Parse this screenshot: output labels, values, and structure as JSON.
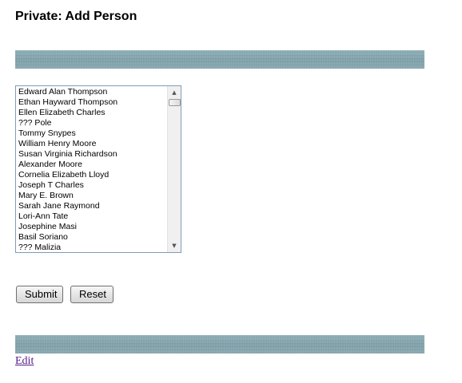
{
  "page": {
    "title": "Private: Add Person"
  },
  "person_list": {
    "items": [
      "Edward Alan Thompson",
      "Ethan Hayward Thompson",
      "Ellen Elizabeth Charles",
      "??? Pole",
      "Tommy Snypes",
      "William Henry Moore",
      "Susan Virginia Richardson",
      "Alexander Moore",
      "Cornelia Elizabeth Lloyd",
      "Joseph T Charles",
      "Mary E. Brown",
      "Sarah Jane Raymond",
      "Lori-Ann Tate",
      "Josephine Masi",
      "Basil Soriano",
      "??? Malizia"
    ]
  },
  "form": {
    "submit_label": "Submit",
    "reset_label": "Reset"
  },
  "footer": {
    "edit_link": "Edit"
  },
  "icons": {
    "scroll_up": "scroll-up-arrow-icon",
    "scroll_down": "scroll-down-arrow-icon"
  },
  "colors": {
    "banner": "#87a7b0",
    "link_visited": "#551a8b",
    "listbox_border": "#7f9db9"
  }
}
